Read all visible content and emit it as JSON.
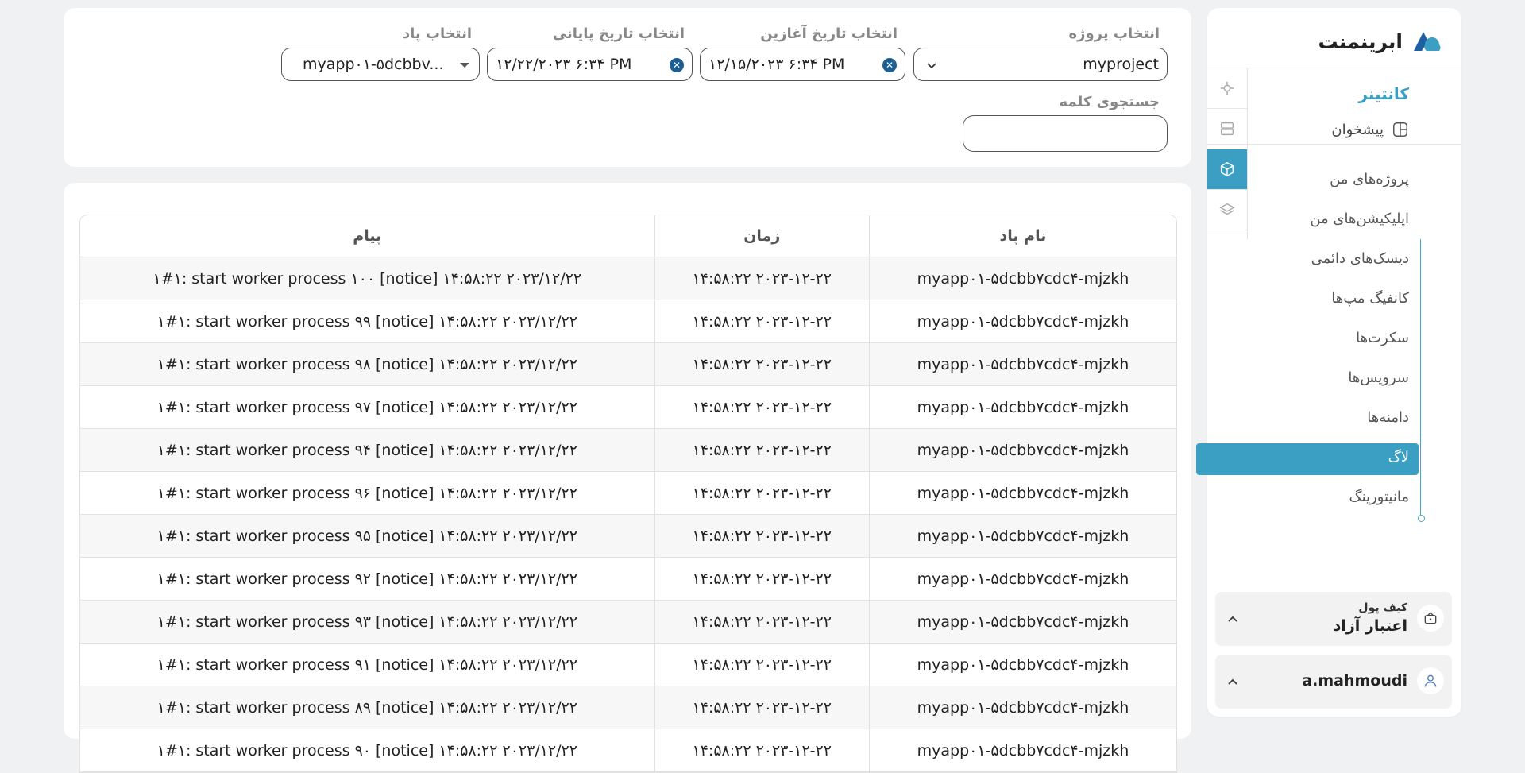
{
  "brand": {
    "name": "ابرینمنت"
  },
  "sidebar": {
    "section_title": "کانتینر",
    "dashboard_label": "پیشخوان",
    "items": [
      {
        "label": "پروژه‌های من"
      },
      {
        "label": "اپلیکیشن‌های من"
      },
      {
        "label": "دیسک‌های دائمی"
      },
      {
        "label": "کانفیگ مپ‌ها"
      },
      {
        "label": "سکرت‌ها"
      },
      {
        "label": "سرویس‌ها"
      },
      {
        "label": "دامنه‌ها"
      },
      {
        "label": "لاگ"
      },
      {
        "label": "مانیتورینگ"
      }
    ],
    "active_item": "لاگ",
    "accent_color": "#3a9fc3",
    "wallet": {
      "title": "کیف پول",
      "plan": "اعتبار آزاد"
    },
    "user": {
      "name": "a.mahmoudi"
    }
  },
  "filters": {
    "project": {
      "label": "انتخاب پروژه",
      "value": "myproject"
    },
    "start_date": {
      "label": "انتخاب تاریخ آغازین",
      "value": "۱۲/۱۵/۲۰۲۳ ۶:۳۴ PM"
    },
    "end_date": {
      "label": "انتخاب تاریخ پایانی",
      "value": "۱۲/۲۲/۲۰۲۳ ۶:۳۴ PM"
    },
    "pod": {
      "label": "انتخاب پاد",
      "value": "myapp۰۱-۵dcbbv..."
    },
    "search": {
      "label": "جستجوی کلمه",
      "value": ""
    }
  },
  "table": {
    "headers": [
      "نام پاد",
      "زمان",
      "پیام"
    ],
    "rows": [
      {
        "pod": "myapp۰۱-۵dcbb۷cdc۴-mjzkh",
        "time": "۱۴:۵۸:۲۲ ۲۰۲۳-۱۲-۲۲",
        "message": "۱#۱: start worker process ۱۰۰ [notice] ۱۴:۵۸:۲۲ ۲۰۲۳/۱۲/۲۲"
      },
      {
        "pod": "myapp۰۱-۵dcbb۷cdc۴-mjzkh",
        "time": "۱۴:۵۸:۲۲ ۲۰۲۳-۱۲-۲۲",
        "message": "۱#۱: start worker process ۹۹ [notice] ۱۴:۵۸:۲۲ ۲۰۲۳/۱۲/۲۲"
      },
      {
        "pod": "myapp۰۱-۵dcbb۷cdc۴-mjzkh",
        "time": "۱۴:۵۸:۲۲ ۲۰۲۳-۱۲-۲۲",
        "message": "۱#۱: start worker process ۹۸ [notice] ۱۴:۵۸:۲۲ ۲۰۲۳/۱۲/۲۲"
      },
      {
        "pod": "myapp۰۱-۵dcbb۷cdc۴-mjzkh",
        "time": "۱۴:۵۸:۲۲ ۲۰۲۳-۱۲-۲۲",
        "message": "۱#۱: start worker process ۹۷ [notice] ۱۴:۵۸:۲۲ ۲۰۲۳/۱۲/۲۲"
      },
      {
        "pod": "myapp۰۱-۵dcbb۷cdc۴-mjzkh",
        "time": "۱۴:۵۸:۲۲ ۲۰۲۳-۱۲-۲۲",
        "message": "۱#۱: start worker process ۹۴ [notice] ۱۴:۵۸:۲۲ ۲۰۲۳/۱۲/۲۲"
      },
      {
        "pod": "myapp۰۱-۵dcbb۷cdc۴-mjzkh",
        "time": "۱۴:۵۸:۲۲ ۲۰۲۳-۱۲-۲۲",
        "message": "۱#۱: start worker process ۹۶ [notice] ۱۴:۵۸:۲۲ ۲۰۲۳/۱۲/۲۲"
      },
      {
        "pod": "myapp۰۱-۵dcbb۷cdc۴-mjzkh",
        "time": "۱۴:۵۸:۲۲ ۲۰۲۳-۱۲-۲۲",
        "message": "۱#۱: start worker process ۹۵ [notice] ۱۴:۵۸:۲۲ ۲۰۲۳/۱۲/۲۲"
      },
      {
        "pod": "myapp۰۱-۵dcbb۷cdc۴-mjzkh",
        "time": "۱۴:۵۸:۲۲ ۲۰۲۳-۱۲-۲۲",
        "message": "۱#۱: start worker process ۹۲ [notice] ۱۴:۵۸:۲۲ ۲۰۲۳/۱۲/۲۲"
      },
      {
        "pod": "myapp۰۱-۵dcbb۷cdc۴-mjzkh",
        "time": "۱۴:۵۸:۲۲ ۲۰۲۳-۱۲-۲۲",
        "message": "۱#۱: start worker process ۹۳ [notice] ۱۴:۵۸:۲۲ ۲۰۲۳/۱۲/۲۲"
      },
      {
        "pod": "myapp۰۱-۵dcbb۷cdc۴-mjzkh",
        "time": "۱۴:۵۸:۲۲ ۲۰۲۳-۱۲-۲۲",
        "message": "۱#۱: start worker process ۹۱ [notice] ۱۴:۵۸:۲۲ ۲۰۲۳/۱۲/۲۲"
      },
      {
        "pod": "myapp۰۱-۵dcbb۷cdc۴-mjzkh",
        "time": "۱۴:۵۸:۲۲ ۲۰۲۳-۱۲-۲۲",
        "message": "۱#۱: start worker process ۸۹ [notice] ۱۴:۵۸:۲۲ ۲۰۲۳/۱۲/۲۲"
      },
      {
        "pod": "myapp۰۱-۵dcbb۷cdc۴-mjzkh",
        "time": "۱۴:۵۸:۲۲ ۲۰۲۳-۱۲-۲۲",
        "message": "۱#۱: start worker process ۹۰ [notice] ۱۴:۵۸:۲۲ ۲۰۲۳/۱۲/۲۲"
      }
    ]
  }
}
